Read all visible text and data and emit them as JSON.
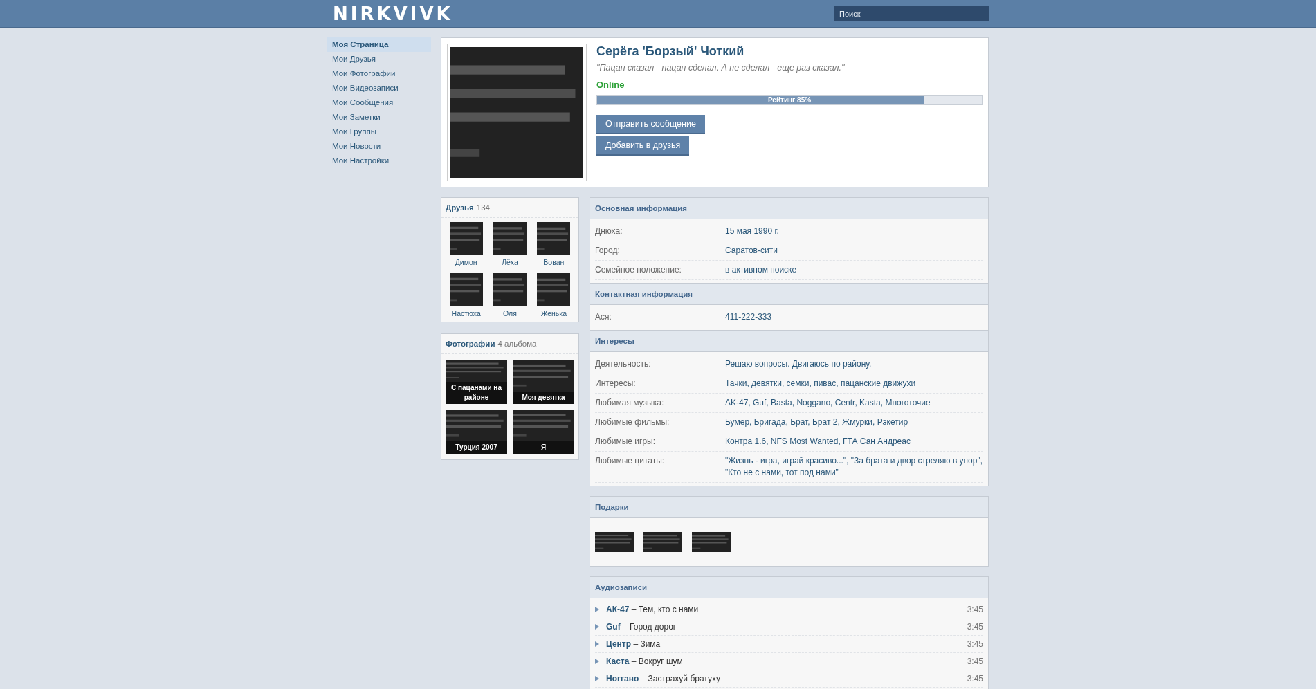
{
  "header": {
    "logo": "NIRKVIVK",
    "search": {
      "placeholder": "Поиск"
    }
  },
  "sidebar": {
    "items": [
      {
        "label": "Моя Страница",
        "selected": true
      },
      {
        "label": "Мои Друзья",
        "selected": false
      },
      {
        "label": "Мои Фотографии",
        "selected": false
      },
      {
        "label": "Мои Видеозаписи",
        "selected": false
      },
      {
        "label": "Мои Сообщения",
        "selected": false
      },
      {
        "label": "Мои Заметки",
        "selected": false
      },
      {
        "label": "Мои Группы",
        "selected": false
      },
      {
        "label": "Мои Новости",
        "selected": false
      },
      {
        "label": "Мои Настройки",
        "selected": false
      }
    ]
  },
  "profile": {
    "name": "Серёга 'Борзый' Чоткий",
    "status": "\"Пацан сказал - пацан сделал. А не сделал - еще раз сказал.\"",
    "online": "Online",
    "rating": {
      "label": "Рейтинг 85%",
      "level": 0.85
    },
    "buttons": [
      "Отправить сообщение",
      "Добавить в друзья"
    ]
  },
  "friends": {
    "title": "Друзья",
    "count": "134",
    "items": [
      {
        "name": "Димон"
      },
      {
        "name": "Лёха"
      },
      {
        "name": "Вован"
      },
      {
        "name": "Настюха"
      },
      {
        "name": "Оля"
      },
      {
        "name": "Женька"
      }
    ]
  },
  "photos": {
    "title": "Фотографии",
    "count": "4 альбома",
    "albums": [
      {
        "caption": "С пацанами на районе"
      },
      {
        "caption": "Моя девятка"
      },
      {
        "caption": "Турция 2007"
      },
      {
        "caption": "Я"
      }
    ]
  },
  "sections": [
    {
      "title": "Основная информация",
      "rows": [
        {
          "label": "Днюха:",
          "value": "15 мая 1990 г."
        },
        {
          "label": "Город:",
          "value": "Саратов-сити"
        },
        {
          "label": "Семейное положение:",
          "value": "в активном поиске"
        }
      ]
    },
    {
      "title": "Контактная информация",
      "rows": [
        {
          "label": "Ася:",
          "value": "411-222-333"
        }
      ]
    },
    {
      "title": "Интересы",
      "rows": [
        {
          "label": "Деятельность:",
          "value": "Решаю вопросы. Двигаюсь по району."
        },
        {
          "label": "Интересы:",
          "value": "Тачки, девятки, семки, пивас, пацанские движухи"
        },
        {
          "label": "Любимая музыка:",
          "value": "AK-47, Guf, Basta, Noggano, Centr, Kasta, Многоточие"
        },
        {
          "label": "Любимые фильмы:",
          "value": "Бумер, Бригада, Брат, Брат 2, Жмурки, Рэкетир"
        },
        {
          "label": "Любимые игры:",
          "value": "Контра 1.6, NFS Most Wanted, ГТА Сан Андреас"
        },
        {
          "label": "Любимые цитаты:",
          "value": "\"Жизнь - игра, играй красиво...\", \"За брата и двор стреляю в упор\", \"Кто не с нами, тот под нами\""
        }
      ]
    }
  ],
  "gifts": {
    "title": "Подарки"
  },
  "audio": {
    "title": "Аудиозаписи",
    "tracks": [
      {
        "song": "**АК-47** – Тем, кто с нами",
        "duration": "3:45"
      },
      {
        "song": "**Guf** – Город дорог",
        "duration": "3:45"
      },
      {
        "song": "**Центр** – Зима",
        "duration": "3:45"
      },
      {
        "song": "**Каста** – Вокруг шум",
        "duration": "3:45"
      },
      {
        "song": "**Ноггано** – Застрахуй братуху",
        "duration": "3:45"
      }
    ]
  }
}
